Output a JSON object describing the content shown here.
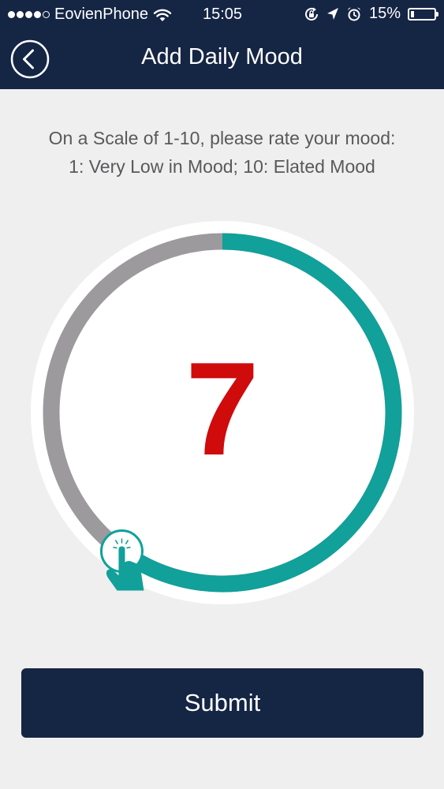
{
  "status_bar": {
    "carrier": "EovienPhone",
    "time": "15:05",
    "battery_percent_label": "15%",
    "battery_level": 0.15,
    "icons": [
      "signal-dots",
      "wifi-icon",
      "rotation-lock-icon",
      "location-arrow-icon",
      "alarm-icon",
      "battery-icon"
    ]
  },
  "header": {
    "title": "Add Daily Mood",
    "back_icon": "chevron-left-circle-icon"
  },
  "instructions": {
    "line1": "On a Scale of 1-10, please rate your mood:",
    "line2": "1: Very Low in Mood; 10: Elated Mood"
  },
  "mood_dial": {
    "value": "7",
    "min": 1,
    "max": 10,
    "fill_fraction": 0.6,
    "handle_icon": "tap-hand-icon"
  },
  "submit": {
    "label": "Submit"
  },
  "colors": {
    "header_bg": "#152544",
    "page_bg": "#efefef",
    "track_gray": "#9c9a9d",
    "progress_teal": "#11a09a",
    "value_red": "#cf0b0b",
    "instruction_text": "#58595b"
  }
}
